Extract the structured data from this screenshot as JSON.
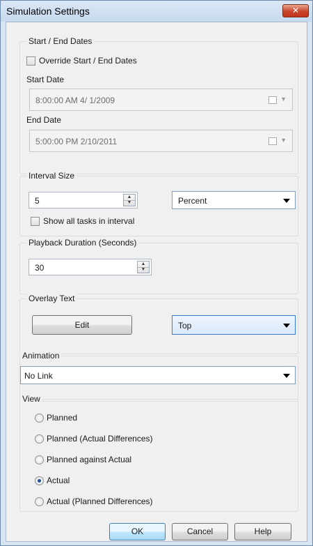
{
  "window": {
    "title": "Simulation Settings",
    "close_glyph": "✕"
  },
  "start_end": {
    "group_label": "Start / End Dates",
    "override_label": "Override Start / End Dates",
    "override_checked": false,
    "start_label": "Start Date",
    "start_value": "8:00:00 AM  4/ 1/2009",
    "end_label": "End Date",
    "end_value": "5:00:00 PM  2/10/2011"
  },
  "interval": {
    "group_label": "Interval Size",
    "value": "5",
    "unit": "Percent",
    "show_all_label": "Show all tasks in interval",
    "show_all_checked": false
  },
  "playback": {
    "group_label": "Playback Duration (Seconds)",
    "value": "30"
  },
  "overlay": {
    "group_label": "Overlay Text",
    "edit_label": "Edit",
    "position": "Top"
  },
  "animation": {
    "group_label": "Animation",
    "value": "No Link"
  },
  "view": {
    "group_label": "View",
    "options": [
      {
        "label": "Planned",
        "checked": false
      },
      {
        "label": "Planned (Actual Differences)",
        "checked": false
      },
      {
        "label": "Planned against Actual",
        "checked": false
      },
      {
        "label": "Actual",
        "checked": true
      },
      {
        "label": "Actual (Planned Differences)",
        "checked": false
      }
    ]
  },
  "buttons": {
    "ok": "OK",
    "cancel": "Cancel",
    "help": "Help"
  },
  "icons": {
    "spin_up": "▲",
    "spin_down": "▼",
    "dropdown": "▼"
  },
  "colors": {
    "title_bar": "#c6d9ee",
    "close_button": "#c8452b",
    "selected_radio": "#1d4f91"
  }
}
